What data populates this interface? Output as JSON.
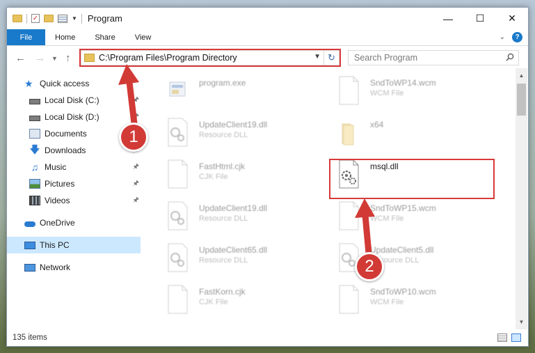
{
  "window": {
    "title": "Program",
    "controls": [
      "minimize",
      "maximize",
      "close"
    ]
  },
  "ribbon": {
    "file_tab": "File",
    "tabs": [
      "Home",
      "Share",
      "View"
    ]
  },
  "address": {
    "path": "C:\\Program Files\\Program Directory",
    "search_placeholder": "Search Program"
  },
  "sidebar": {
    "items": [
      {
        "label": "Quick access",
        "icon": "star-icon"
      },
      {
        "label": "Local Disk (C:)",
        "icon": "drive-icon",
        "pinned": true
      },
      {
        "label": "Local Disk (D:)",
        "icon": "drive-icon",
        "pinned": true
      },
      {
        "label": "Documents",
        "icon": "documents-icon",
        "pinned": true
      },
      {
        "label": "Downloads",
        "icon": "downloads-icon",
        "pinned": true
      },
      {
        "label": "Music",
        "icon": "music-icon",
        "pinned": true
      },
      {
        "label": "Pictures",
        "icon": "pictures-icon",
        "pinned": true
      },
      {
        "label": "Videos",
        "icon": "videos-icon",
        "pinned": true
      },
      {
        "label": "OneDrive",
        "icon": "cloud-icon"
      },
      {
        "label": "This PC",
        "icon": "monitor-icon",
        "selected": true
      },
      {
        "label": "Network",
        "icon": "network-icon"
      }
    ]
  },
  "files": [
    {
      "name": "program.exe",
      "type": "",
      "icon": "exe-icon"
    },
    {
      "name": "SndToWP14.wcm",
      "type": "WCM File",
      "icon": "blank-file-icon"
    },
    {
      "name": "UpdateClient19.dll",
      "type": "Resource DLL",
      "icon": "dll-gear-icon"
    },
    {
      "name": "x64",
      "type": "",
      "icon": "folder-icon"
    },
    {
      "name": "FastHtml.cjk",
      "type": "CJK File",
      "icon": "blank-file-icon"
    },
    {
      "name": "msql.dll",
      "type": "",
      "icon": "dll-gear-icon",
      "highlighted": true
    },
    {
      "name": "UpdateClient19.dll",
      "type": "Resource DLL",
      "icon": "dll-gear-icon"
    },
    {
      "name": "SndToWP15.wcm",
      "type": "WCM File",
      "icon": "blank-file-icon"
    },
    {
      "name": "UpdateClient65.dll",
      "type": "Resource DLL",
      "icon": "dll-gear-icon"
    },
    {
      "name": "UpdateClient5.dll",
      "type": "Resource DLL",
      "icon": "dll-gear-icon"
    },
    {
      "name": "FastKorn.cjk",
      "type": "CJK File",
      "icon": "blank-file-icon"
    },
    {
      "name": "SndToWP10.wcm",
      "type": "WCM File",
      "icon": "blank-file-icon"
    }
  ],
  "status": {
    "item_count": "135 items"
  },
  "callouts": [
    {
      "number": "1"
    },
    {
      "number": "2"
    }
  ],
  "colors": {
    "accent": "#1979ca",
    "highlight": "#d9393a",
    "selection": "#cce8ff"
  }
}
